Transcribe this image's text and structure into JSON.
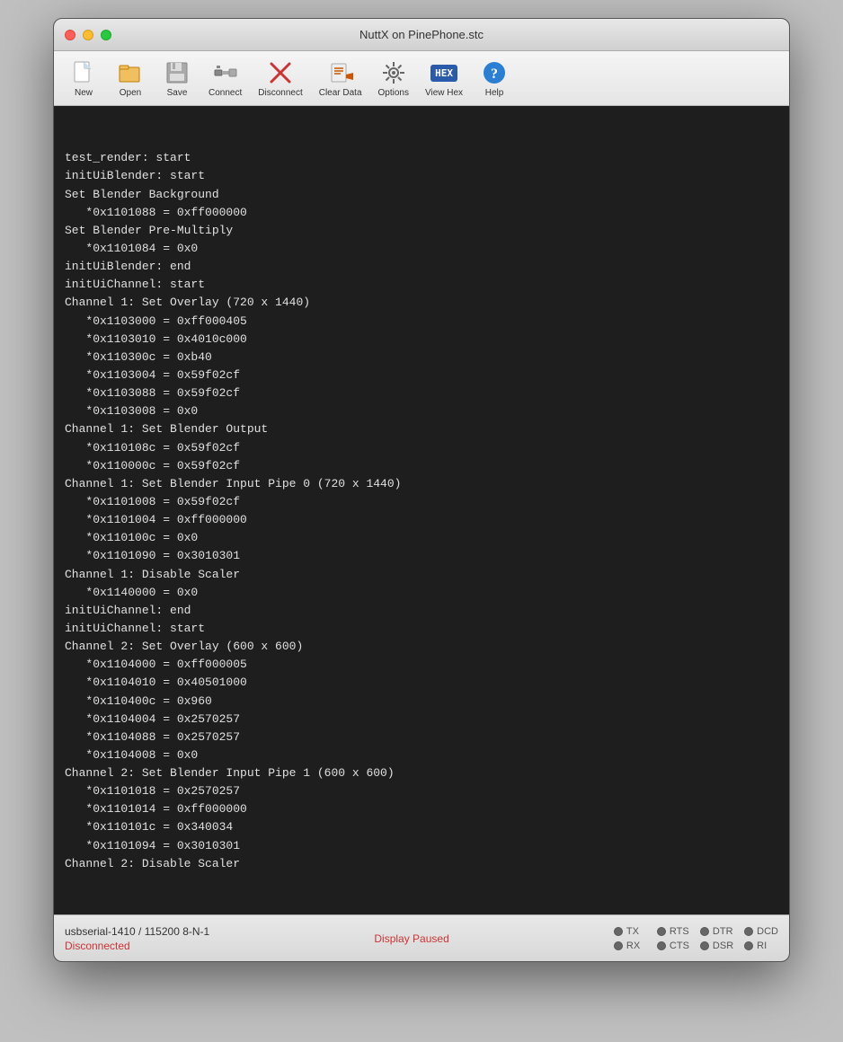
{
  "window": {
    "title": "NuttX on PinePhone.stc"
  },
  "toolbar": {
    "items": [
      {
        "id": "new",
        "label": "New",
        "icon": "📄"
      },
      {
        "id": "open",
        "label": "Open",
        "icon": "📂"
      },
      {
        "id": "save",
        "label": "Save",
        "icon": "💾"
      },
      {
        "id": "connect",
        "label": "Connect",
        "icon": "🔌"
      },
      {
        "id": "disconnect",
        "label": "Disconnect",
        "icon": "✖"
      },
      {
        "id": "clear",
        "label": "Clear Data",
        "icon": "🧹"
      },
      {
        "id": "options",
        "label": "Options",
        "icon": "⚙"
      },
      {
        "id": "viewhex",
        "label": "View Hex",
        "icon": "HEX"
      },
      {
        "id": "help",
        "label": "Help",
        "icon": "❓"
      }
    ]
  },
  "terminal": {
    "lines": [
      "test_render: start",
      "initUiBlender: start",
      "Set Blender Background",
      "   *0x1101088 = 0xff000000",
      "Set Blender Pre-Multiply",
      "   *0x1101084 = 0x0",
      "initUiBlender: end",
      "initUiChannel: start",
      "Channel 1: Set Overlay (720 x 1440)",
      "   *0x1103000 = 0xff000405",
      "   *0x1103010 = 0x4010c000",
      "   *0x110300c = 0xb40",
      "   *0x1103004 = 0x59f02cf",
      "   *0x1103088 = 0x59f02cf",
      "   *0x1103008 = 0x0",
      "Channel 1: Set Blender Output",
      "   *0x110108c = 0x59f02cf",
      "   *0x110000c = 0x59f02cf",
      "Channel 1: Set Blender Input Pipe 0 (720 x 1440)",
      "   *0x1101008 = 0x59f02cf",
      "   *0x1101004 = 0xff000000",
      "   *0x110100c = 0x0",
      "   *0x1101090 = 0x3010301",
      "Channel 1: Disable Scaler",
      "   *0x1140000 = 0x0",
      "initUiChannel: end",
      "initUiChannel: start",
      "Channel 2: Set Overlay (600 x 600)",
      "   *0x1104000 = 0xff000005",
      "   *0x1104010 = 0x40501000",
      "   *0x110400c = 0x960",
      "   *0x1104004 = 0x2570257",
      "   *0x1104088 = 0x2570257",
      "   *0x1104008 = 0x0",
      "Channel 2: Set Blender Input Pipe 1 (600 x 600)",
      "   *0x1101018 = 0x2570257",
      "   *0x1101014 = 0xff000000",
      "   *0x110101c = 0x340034",
      "   *0x1101094 = 0x3010301",
      "Channel 2: Disable Scaler"
    ]
  },
  "statusbar": {
    "connection": "usbserial-1410 / 115200 8-N-1",
    "state": "Disconnected",
    "paused_label": "Display Paused",
    "signals": {
      "col1": [
        {
          "label": "TX",
          "active": false
        },
        {
          "label": "RX",
          "active": false
        }
      ],
      "col2": [
        {
          "label": "RTS",
          "active": false
        },
        {
          "label": "CTS",
          "active": false
        }
      ],
      "col3": [
        {
          "label": "DTR",
          "active": false
        },
        {
          "label": "DSR",
          "active": false
        }
      ],
      "col4": [
        {
          "label": "DCD",
          "active": false
        },
        {
          "label": "RI",
          "active": false
        }
      ]
    }
  }
}
